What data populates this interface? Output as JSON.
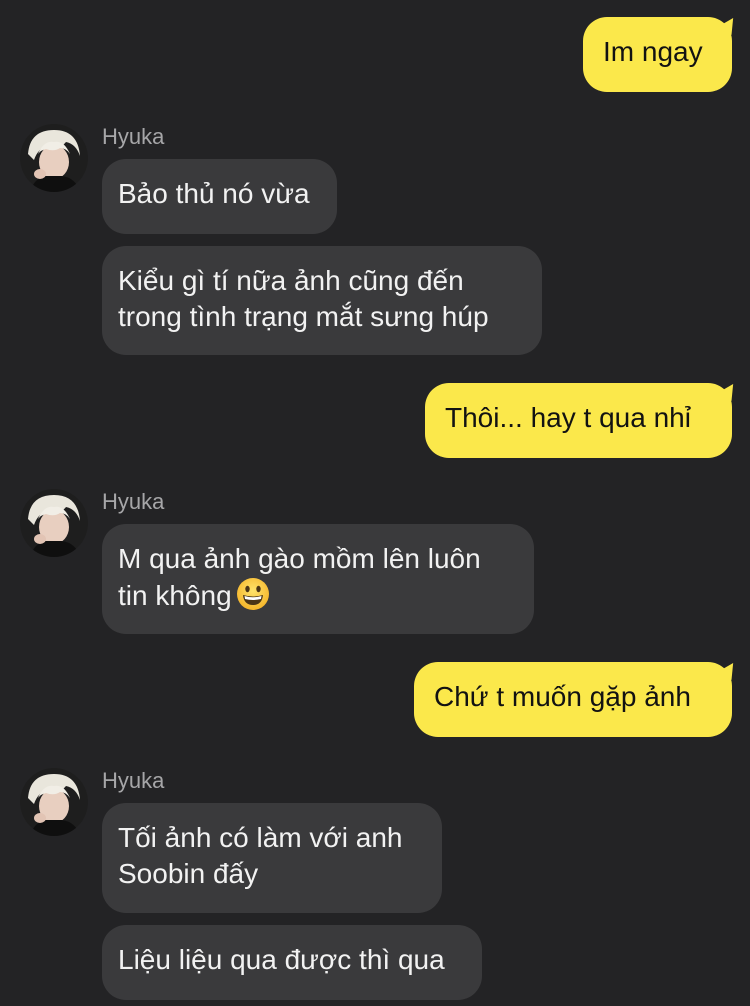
{
  "chat": {
    "messages": [
      {
        "dir": "out",
        "lines": [
          "Im ngay"
        ]
      },
      {
        "dir": "in",
        "sender": "Hyuka",
        "lines": [
          "Bảo thủ nó vừa"
        ]
      },
      {
        "dir": "in",
        "lines": [
          "Kiểu gì tí nữa ảnh cũng đến",
          "trong tình trạng mắt sưng húp"
        ]
      },
      {
        "dir": "out",
        "lines": [
          "Thôi... hay t qua nhỉ"
        ]
      },
      {
        "dir": "in",
        "sender": "Hyuka",
        "lines": [
          "M qua ảnh gào mồm lên luôn",
          "tin không"
        ],
        "emoji": "grinning-face-emoji"
      },
      {
        "dir": "out",
        "lines": [
          "Chứ t muốn gặp ảnh"
        ]
      },
      {
        "dir": "in",
        "sender": "Hyuka",
        "lines": [
          "Tối ảnh có làm với anh",
          "Soobin đấy"
        ]
      },
      {
        "dir": "in",
        "lines": [
          "Liệu liệu qua được thì qua"
        ]
      }
    ]
  },
  "colors": {
    "background": "#232325",
    "outgoing_bubble": "#fbe84b",
    "incoming_bubble": "#3a3a3c",
    "sender_name": "#a6a6a8"
  }
}
